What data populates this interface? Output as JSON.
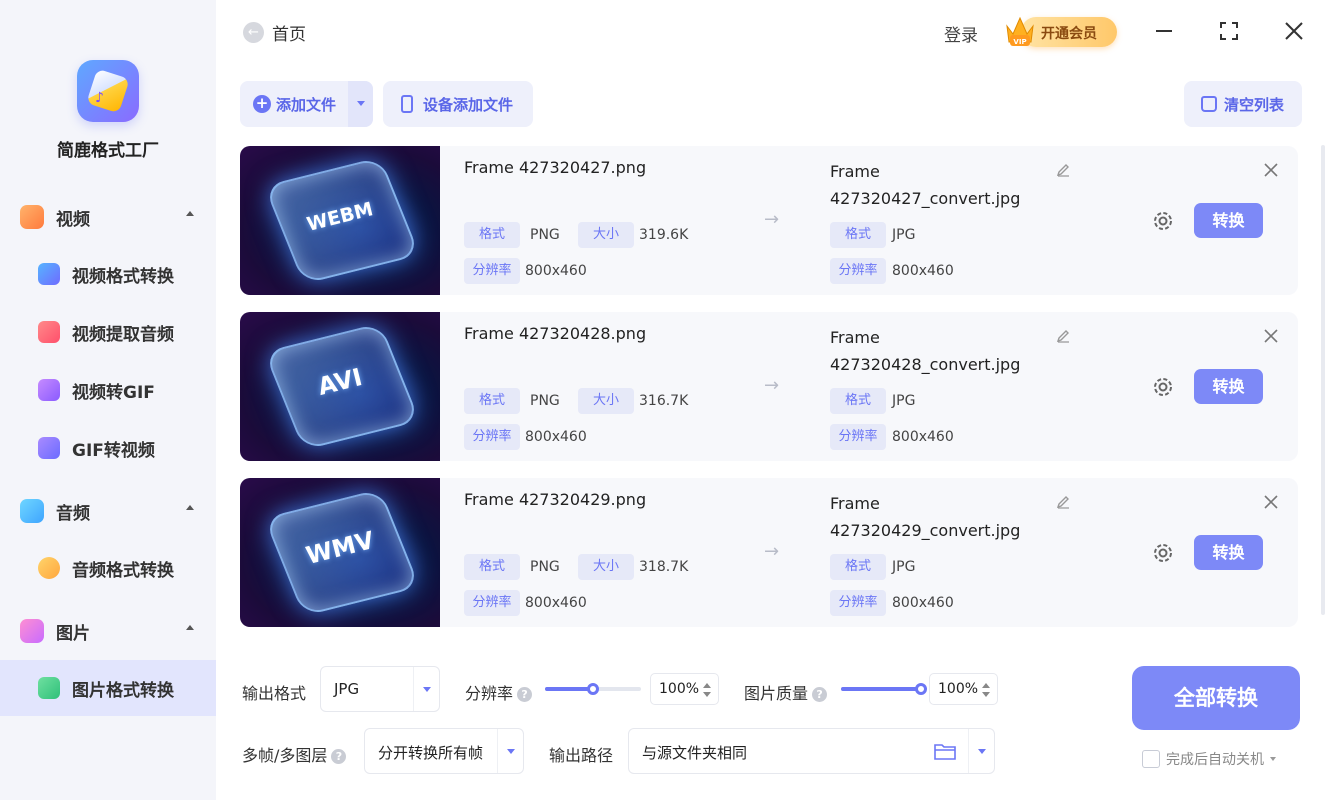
{
  "app": {
    "name": "简鹿格式工厂",
    "home_label": "首页",
    "login_label": "登录",
    "vip_label": "开通会员",
    "vip_badge": "VIP"
  },
  "sidebar": {
    "groups": [
      {
        "label": "视频",
        "icon": "video-icon",
        "items": [
          {
            "label": "视频格式转换",
            "icon": "video-convert-icon"
          },
          {
            "label": "视频提取音频",
            "icon": "audio-extract-icon"
          },
          {
            "label": "视频转GIF",
            "icon": "gif-icon"
          },
          {
            "label": "GIF转视频",
            "icon": "gif-video-icon"
          }
        ]
      },
      {
        "label": "音频",
        "icon": "music-icon",
        "items": [
          {
            "label": "音频格式转换",
            "icon": "headphone-icon"
          }
        ]
      },
      {
        "label": "图片",
        "icon": "image-icon",
        "items": [
          {
            "label": "图片格式转换",
            "icon": "image-convert-icon",
            "active": true
          }
        ]
      }
    ]
  },
  "toolbar": {
    "add_file": "添加文件",
    "device_add": "设备添加文件",
    "clear_list": "清空列表"
  },
  "labels": {
    "format": "格式",
    "size": "大小",
    "resolution": "分辨率",
    "convert": "转换"
  },
  "files": [
    {
      "thumb_text": "WEBM",
      "src_name": "Frame 427320427.png",
      "src_format": "PNG",
      "src_size": "319.6K",
      "src_res": "800x460",
      "dst_name": "Frame 427320427_convert.jpg",
      "dst_format": "JPG",
      "dst_res": "800x460"
    },
    {
      "thumb_text": "AVI",
      "src_name": "Frame 427320428.png",
      "src_format": "PNG",
      "src_size": "316.7K",
      "src_res": "800x460",
      "dst_name": "Frame 427320428_convert.jpg",
      "dst_format": "JPG",
      "dst_res": "800x460"
    },
    {
      "thumb_text": "WMV",
      "src_name": "Frame 427320429.png",
      "src_format": "PNG",
      "src_size": "318.7K",
      "src_res": "800x460",
      "dst_name": "Frame 427320429_convert.jpg",
      "dst_format": "JPG",
      "dst_res": "800x460"
    }
  ],
  "options": {
    "output_format_label": "输出格式",
    "output_format_value": "JPG",
    "resolution_label": "分辨率",
    "resolution_value": "100%",
    "resolution_slider_fraction": 0.5,
    "quality_label": "图片质量",
    "quality_value": "100%",
    "quality_slider_fraction": 1.0,
    "multiframe_label": "多帧/多图层",
    "multiframe_value": "分开转换所有帧",
    "output_path_label": "输出路径",
    "output_path_value": "与源文件夹相同",
    "convert_all": "全部转换",
    "auto_shutdown": "完成后自动关机"
  },
  "colors": {
    "accent": "#7d89f7",
    "accent_text": "#5a66e8",
    "sidebar_bg": "#f4f5fa",
    "active_item_bg": "#e2e5fd"
  }
}
